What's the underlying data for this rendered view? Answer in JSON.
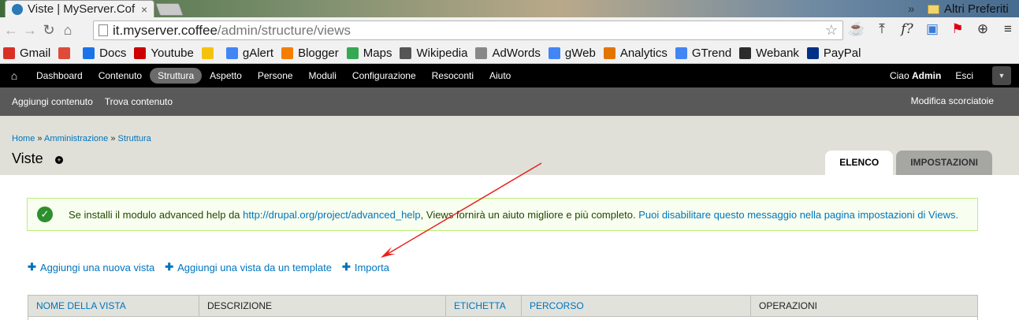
{
  "browser": {
    "tab_title": "Viste | MyServer.Cof",
    "tab_close": "×",
    "url_host": "it.myserver.coffee",
    "url_path": "/admin/structure/views",
    "bookmarks": [
      {
        "label": "Gmail",
        "color": "#d93025"
      },
      {
        "label": "",
        "color": "#dd4b39"
      },
      {
        "label": "Docs",
        "color": "#1a73e8"
      },
      {
        "label": "Youtube",
        "color": "#cc0000"
      },
      {
        "label": "",
        "color": "#f4c20d"
      },
      {
        "label": "gAlert",
        "color": "#4285f4"
      },
      {
        "label": "Blogger",
        "color": "#f57d00"
      },
      {
        "label": "Maps",
        "color": "#34a853"
      },
      {
        "label": "Wikipedia",
        "color": "#555555"
      },
      {
        "label": "AdWords",
        "color": "#888888"
      },
      {
        "label": "gWeb",
        "color": "#4285f4"
      },
      {
        "label": "Analytics",
        "color": "#e37400"
      },
      {
        "label": "GTrend",
        "color": "#4285f4"
      },
      {
        "label": "Webank",
        "color": "#2b2b2b"
      },
      {
        "label": "PayPal",
        "color": "#003087"
      }
    ],
    "bookmarks_more": "»",
    "other_bookmarks": "Altri Preferiti"
  },
  "admin_toolbar": {
    "items": [
      "Dashboard",
      "Contenuto",
      "Struttura",
      "Aspetto",
      "Persone",
      "Moduli",
      "Configurazione",
      "Resoconti",
      "Aiuto"
    ],
    "active_index": 2,
    "greeting": "Ciao",
    "user": "Admin",
    "logout": "Esci"
  },
  "shortcuts": {
    "items": [
      "Aggiungi contenuto",
      "Trova contenuto"
    ],
    "edit": "Modifica scorciatoie"
  },
  "page": {
    "breadcrumb": [
      "Home",
      "Amministrazione",
      "Struttura"
    ],
    "breadcrumb_sep": "»",
    "title": "Viste",
    "tabs": [
      "ELENCO",
      "IMPOSTAZIONI"
    ]
  },
  "status": {
    "text_before": "Se installi il modulo advanced help da",
    "link1": "http://drupal.org/project/advanced_help",
    "text_middle": ", Views fornirà un aiuto migliore e più completo.",
    "link2": "Puoi disabilitare questo messaggio nella pagina impostazioni di Views."
  },
  "actions": [
    "Aggiungi una nuova vista",
    "Aggiungi una vista da un template",
    "Importa"
  ],
  "table": {
    "headers": [
      "NOME DELLA VISTA",
      "DESCRIZIONE",
      "ETICHETTA",
      "PERCORSO",
      "OPERAZIONI"
    ]
  },
  "colors": {
    "link": "#0074bd",
    "annotation_arrow": "#e8201c",
    "status_ok": "#2d8f2d"
  }
}
